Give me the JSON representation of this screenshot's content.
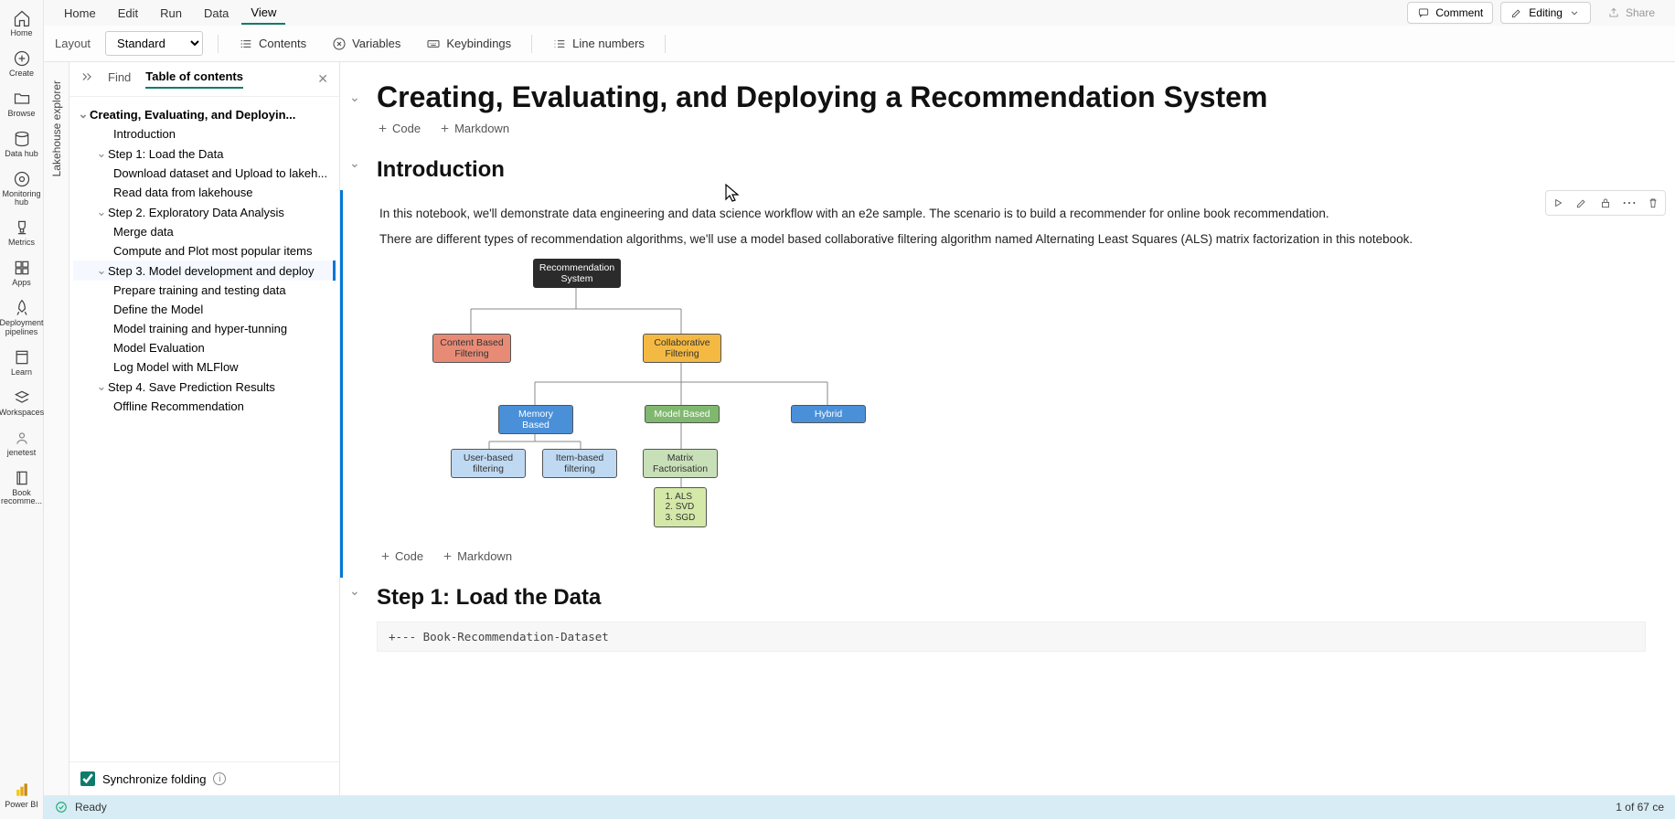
{
  "nav": {
    "home": "Home",
    "create": "Create",
    "browse": "Browse",
    "datahub": "Data hub",
    "monitoring": "Monitoring hub",
    "metrics": "Metrics",
    "apps": "Apps",
    "deployment": "Deployment pipelines",
    "learn": "Learn",
    "workspaces": "Workspaces",
    "jenetest": "jenetest",
    "book": "Book recomme...",
    "powerbi": "Power BI"
  },
  "menu": {
    "home": "Home",
    "edit": "Edit",
    "run": "Run",
    "data": "Data",
    "view": "View"
  },
  "topright": {
    "comment": "Comment",
    "editing": "Editing",
    "share": "Share"
  },
  "toolbar": {
    "layout_label": "Layout",
    "layout_value": "Standard",
    "contents": "Contents",
    "variables": "Variables",
    "keybindings": "Keybindings",
    "linenumbers": "Line numbers"
  },
  "lakehouse_strip": "Lakehouse explorer",
  "toc": {
    "find": "Find",
    "title": "Table of contents",
    "root": "Creating, Evaluating, and Deployin...",
    "items": [
      "Introduction",
      "Step 1: Load the Data",
      "Download dataset and Upload to lakeh...",
      "Read data from lakehouse",
      "Step 2. Exploratory Data Analysis",
      "Merge data",
      "Compute and Plot most popular items",
      "Step 3. Model development and deploy",
      "Prepare training and testing data",
      "Define the Model",
      "Model training and hyper-tunning",
      "Model Evaluation",
      "Log Model with MLFlow",
      "Step 4. Save Prediction Results",
      "Offline Recommendation"
    ],
    "sync": "Synchronize folding"
  },
  "notebook": {
    "h1": "Creating, Evaluating, and Deploying a Recommendation System",
    "h2_intro": "Introduction",
    "p1": "In this notebook, we'll demonstrate data engineering and data science workflow with an e2e sample. The scenario is to build a recommender for online book recommendation.",
    "p2": "There are different types of recommendation algorithms, we'll use a model based collaborative filtering algorithm named Alternating Least Squares (ALS) matrix factorization in this notebook.",
    "add_code": "Code",
    "add_markdown": "Markdown",
    "h2_step1": "Step 1: Load the Data",
    "code1": "+--- Book-Recommendation-Dataset",
    "diagram": {
      "root": "Recommendation System",
      "content": "Content Based Filtering",
      "collab": "Collaborative Filtering",
      "memory": "Memory Based",
      "model": "Model Based",
      "hybrid": "Hybrid",
      "user": "User-based filtering",
      "item": "Item-based filtering",
      "matrix": "Matrix Factorisation",
      "algos": "1. ALS\n2. SVD\n3. SGD"
    }
  },
  "status": {
    "ready": "Ready",
    "cells": "1 of 67 ce"
  }
}
